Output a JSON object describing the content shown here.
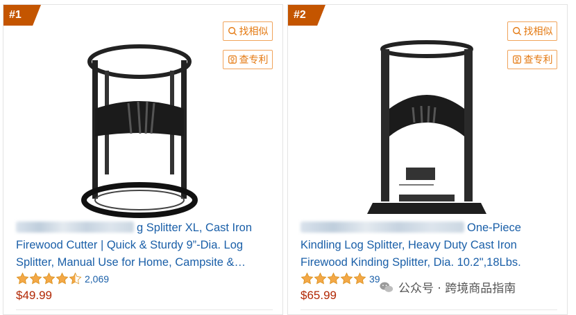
{
  "tools": {
    "find_similar": "找相似",
    "check_patent": "查专利"
  },
  "products": [
    {
      "rank": "#1",
      "title_visible": "g Splitter XL, Cast Iron Firewood Cutter | Quick & Sturdy 9”-Dia. Log Splitter, Manual Use for Home, Campsite &…",
      "rating_count": "2,069",
      "rating_stars": 4.5,
      "price": "$49.99"
    },
    {
      "rank": "#2",
      "title_visible": "One-Piece Kindling Log Splitter, Heavy Duty Cast Iron Firewood Kinding Splitter, Dia. 10.2\",18Lbs.",
      "rating_count": "39",
      "rating_stars": 5,
      "price": "$65.99"
    }
  ],
  "watermark": "公众号 · 跨境商品指南",
  "colors": {
    "rank_badge": "#c45500",
    "link": "#1a5fa8",
    "price": "#b12704",
    "star": "#f3a847",
    "tool_border": "#f0a35a"
  }
}
